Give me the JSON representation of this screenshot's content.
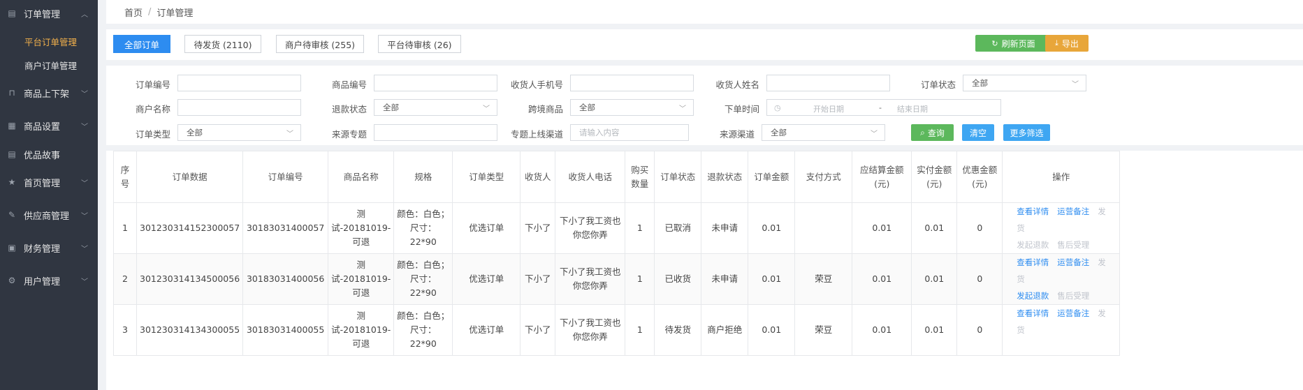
{
  "sidebar": {
    "groups": [
      {
        "label": "订单管理",
        "icon": "order-icon"
      },
      {
        "label": "商品上下架",
        "icon": "bag-icon"
      },
      {
        "label": "商品设置",
        "icon": "grid-icon"
      },
      {
        "label": "优品故事",
        "icon": "document-icon"
      },
      {
        "label": "首页管理",
        "icon": "star-icon"
      },
      {
        "label": "供应商管理",
        "icon": "pencil-icon"
      },
      {
        "label": "财务管理",
        "icon": "ledger-icon"
      },
      {
        "label": "用户管理",
        "icon": "user-gear-icon"
      }
    ],
    "sub_items": [
      {
        "label": "平台订单管理",
        "active": true
      },
      {
        "label": "商户订单管理",
        "active": false
      }
    ]
  },
  "breadcrumb": {
    "home": "首页",
    "separator": "/",
    "current": "订单管理"
  },
  "tabs": [
    {
      "label": "全部订单",
      "active": true
    },
    {
      "label": "待发货 (2110)",
      "active": false
    },
    {
      "label": "商户待审核 (255)",
      "active": false
    },
    {
      "label": "平台待审核 (26)",
      "active": false
    }
  ],
  "actions": {
    "refresh": "刷新页面",
    "export": "导出"
  },
  "filters": {
    "order_no": "订单编号",
    "goods_no": "商品编号",
    "receiver_phone": "收货人手机号",
    "receiver_name": "收货人姓名",
    "order_status": "订单状态",
    "order_status_value": "全部",
    "merchant_name": "商户名称",
    "refund_status": "退款状态",
    "refund_status_value": "全部",
    "cross_border": "跨境商品",
    "cross_border_value": "全部",
    "order_time": "下单时间",
    "start_date_ph": "开始日期",
    "date_sep": "-",
    "end_date_ph": "结束日期",
    "order_type": "订单类型",
    "order_type_value": "全部",
    "source_topic": "来源专题",
    "topic_channel": "专题上线渠道",
    "topic_channel_ph": "请输入内容",
    "source_channel": "来源渠道",
    "source_channel_value": "全部",
    "query_btn": "查询",
    "clear_btn": "清空",
    "more_btn": "更多筛选"
  },
  "table": {
    "headers": [
      "序号",
      "订单数据",
      "订单编号",
      "商品名称",
      "规格",
      "订单类型",
      "收货人",
      "收货人电话",
      "购买数量",
      "订单状态",
      "退款状态",
      "订单金额",
      "支付方式",
      "应结算金额(元)",
      "实付金额(元)",
      "优惠金额(元)",
      "操作"
    ],
    "rows": [
      {
        "idx": "1",
        "data": "301230314152300057",
        "order_no": "30183031400057",
        "goods": "测试-20181019-可退",
        "spec": "颜色：白色；尺寸：22*90",
        "type": "优选订单",
        "receiver": "下小了",
        "phone": "下小了我工资也你您你弄",
        "qty": "1",
        "status": "已取消",
        "refund": "未申请",
        "amount": "0.01",
        "pay": "",
        "settle": "0.01",
        "paid": "0.01",
        "discount": "0",
        "op1": "查看详情",
        "op2": "运营备注",
        "op3": "发货",
        "op4": "发起退款",
        "op5": "售后受理",
        "op4_enabled": false
      },
      {
        "idx": "2",
        "data": "301230314134500056",
        "order_no": "30183031400056",
        "goods": "测试-20181019-可退",
        "spec": "颜色：白色；尺寸：22*90",
        "type": "优选订单",
        "receiver": "下小了",
        "phone": "下小了我工资也你您你弄",
        "qty": "1",
        "status": "已收货",
        "refund": "未申请",
        "amount": "0.01",
        "pay": "荣豆",
        "settle": "0.01",
        "paid": "0.01",
        "discount": "0",
        "op1": "查看详情",
        "op2": "运营备注",
        "op3": "发货",
        "op4": "发起退款",
        "op5": "售后受理",
        "op4_enabled": true
      },
      {
        "idx": "3",
        "data": "301230314134300055",
        "order_no": "30183031400055",
        "goods": "测试-20181019-可退",
        "spec": "颜色：白色；尺寸：22*90",
        "type": "优选订单",
        "receiver": "下小了",
        "phone": "下小了我工资也你您你弄",
        "qty": "1",
        "status": "待发货",
        "refund": "商户拒绝",
        "amount": "0.01",
        "pay": "荣豆",
        "settle": "0.01",
        "paid": "0.01",
        "discount": "0",
        "op1": "查看详情",
        "op2": "运营备注",
        "op3": "发货",
        "op4": "",
        "op5": "",
        "op4_enabled": false
      }
    ]
  },
  "colors": {
    "sidebar_bg": "#303641",
    "active_sub": "#f3b14b",
    "primary": "#2d8cf0",
    "green": "#5cb85c",
    "orange": "#e8a63a",
    "link": "#2d8cf0"
  }
}
